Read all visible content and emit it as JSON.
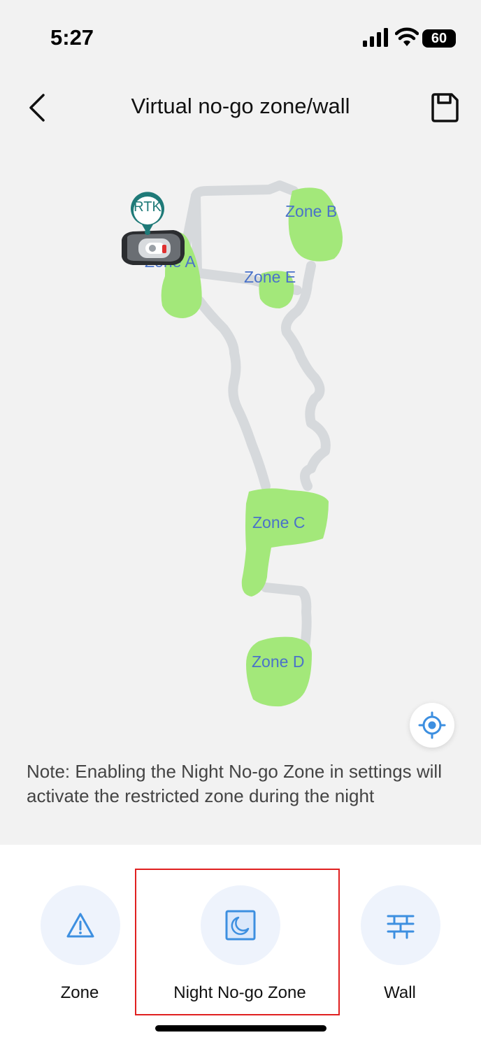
{
  "status_bar": {
    "time": "5:27",
    "battery_level": "60",
    "icons": [
      "signal-icon",
      "wifi-icon",
      "battery-icon"
    ]
  },
  "nav": {
    "title": "Virtual no-go zone/wall",
    "back_icon": "chevron-left-icon",
    "save_icon": "save-icon"
  },
  "map": {
    "marker_label": "RTK",
    "zones": [
      {
        "id": "a",
        "label": "Zone A"
      },
      {
        "id": "b",
        "label": "Zone B"
      },
      {
        "id": "c",
        "label": "Zone C"
      },
      {
        "id": "d",
        "label": "Zone D"
      },
      {
        "id": "e",
        "label": "Zone E"
      }
    ],
    "zone_color": "#a3e87a",
    "path_color": "#d6d9dc",
    "label_color": "#4a72c9",
    "locate_icon": "crosshair-icon"
  },
  "note": "Note: Enabling the Night No-go Zone in settings will activate the restricted zone during the night",
  "tools": [
    {
      "label": "Zone",
      "icon": "warning-triangle-icon"
    },
    {
      "label": "Night No-go Zone",
      "icon": "moon-icon"
    },
    {
      "label": "Wall",
      "icon": "wall-icon"
    }
  ],
  "colors": {
    "accent": "#3d8fe0",
    "tool_bg": "#eef3fc",
    "highlight": "#e02020"
  }
}
